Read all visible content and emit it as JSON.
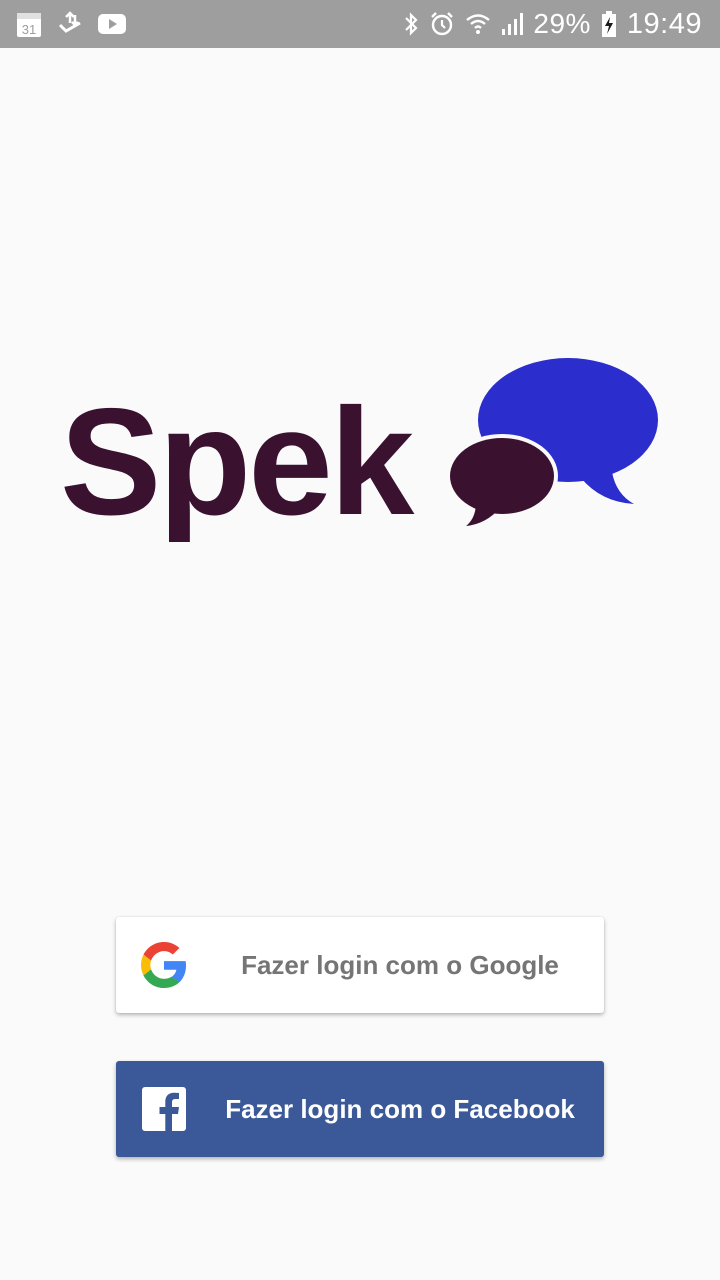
{
  "status_bar": {
    "icons_left": [
      "calendar-icon",
      "download-icon",
      "youtube-icon"
    ],
    "calendar_day": "31",
    "icons_right": [
      "bluetooth-icon",
      "alarm-icon",
      "wifi-icon",
      "signal-icon",
      "battery-charging-icon"
    ],
    "battery": "29%",
    "time": "19:49",
    "background_color": "#9e9e9e"
  },
  "logo": {
    "text": "Spek",
    "text_color": "#3a1230",
    "bubble_blue": "#2b2dcc",
    "bubble_dark": "#3a1230"
  },
  "login": {
    "google_label": "Fazer login com o Google",
    "facebook_label": "Fazer login com o Facebook",
    "google_icon": "google-g-icon",
    "facebook_icon": "facebook-f-icon",
    "facebook_color": "#3b5998"
  }
}
